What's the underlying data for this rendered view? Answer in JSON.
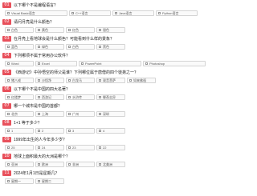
{
  "questions": [
    {
      "num": "01",
      "text": "以下哪个不是编程语言？",
      "options": [
        "Visual Basic语言",
        "C++语言",
        "Java语言",
        "Python语言"
      ]
    },
    {
      "num": "02",
      "text": "请问月亮是什么颜色？",
      "options": [
        "白色",
        "黄色",
        "红色",
        "银色"
      ]
    },
    {
      "num": "03",
      "text": "在月亮上看地球会是什么颜色？可能看到什么样的景象？",
      "options": [
        "蓝色",
        "绿色",
        "白色",
        "黑色"
      ]
    },
    {
      "num": "04",
      "text": "下列哪项不属于常用办公软件？",
      "options": [
        "Word",
        "Excel",
        "PowerPoint",
        "Photoshop"
      ]
    },
    {
      "num": "05",
      "text": "《西游记》中孙悟空的师父是谁？下列哪位属于唐僧的四个徒弟之一？",
      "options": [
        "猪八戒",
        "沙悟净",
        "白龙马",
        "观音菩萨",
        "如来佛祖"
      ]
    },
    {
      "num": "06",
      "text": "以下哪个不是中国的四大名著？",
      "options": [
        "红楼梦",
        "西游记",
        "水浒传",
        "聊斋志异"
      ]
    },
    {
      "num": "07",
      "text": "哪一个城市是中国的首都？",
      "options": [
        "北京",
        "上海",
        "广州",
        "深圳"
      ]
    },
    {
      "num": "08",
      "text": "1+1 等于多少？",
      "options": [
        "1",
        "2",
        "3",
        "4"
      ]
    },
    {
      "num": "09",
      "text": "1999年出生的人今年多少岁？",
      "options": [
        "25",
        "24",
        "23",
        "22"
      ]
    },
    {
      "num": "10",
      "text": "地球上面积最大的大洲是哪个？",
      "options": [
        "亚洲",
        "欧洲",
        "非洲",
        "北美洲"
      ]
    },
    {
      "num": "11",
      "text": "2024年1月1日是星期几？",
      "options": [
        "星期一",
        "星期二"
      ]
    }
  ]
}
